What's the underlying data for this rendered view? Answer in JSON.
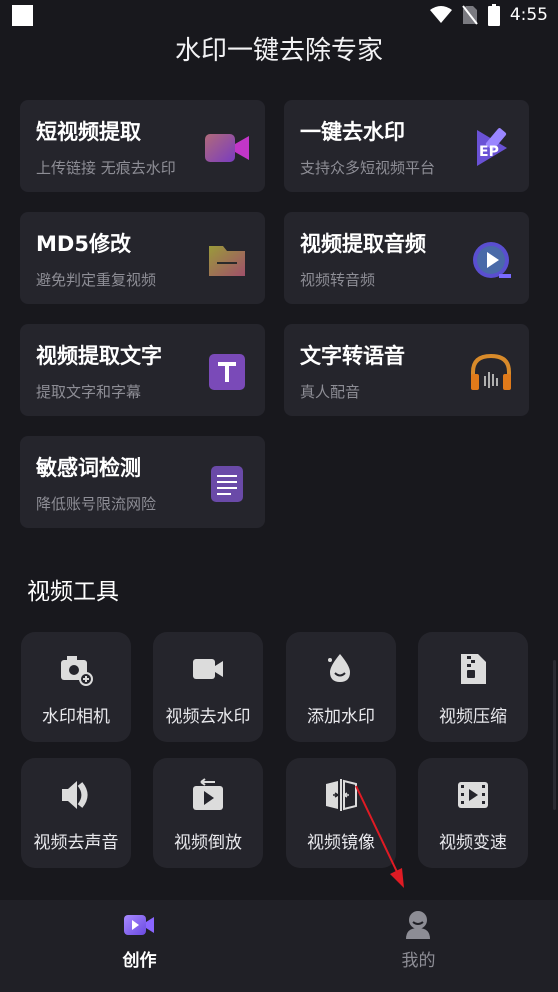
{
  "status_bar": {
    "time": "4:55"
  },
  "app": {
    "title": "水印一键去除专家"
  },
  "feature_cards": [
    {
      "title": "短视频提取",
      "subtitle": "上传链接 无痕去水印",
      "icon": "video-camera-icon"
    },
    {
      "title": "一键去水印",
      "subtitle": "支持众多短视频平台",
      "icon": "watermark-eraser-icon"
    },
    {
      "title": "MD5修改",
      "subtitle": "避免判定重复视频",
      "icon": "folder-icon"
    },
    {
      "title": "视频提取音频",
      "subtitle": "视频转音频",
      "icon": "play-audio-icon"
    },
    {
      "title": "视频提取文字",
      "subtitle": "提取文字和字幕",
      "icon": "text-t-icon"
    },
    {
      "title": "文字转语音",
      "subtitle": "真人配音",
      "icon": "headphones-icon"
    },
    {
      "title": "敏感词检测",
      "subtitle": "降低账号限流网险",
      "icon": "document-lines-icon"
    }
  ],
  "video_tools": {
    "title": "视频工具",
    "items": [
      {
        "label": "水印相机",
        "icon": "camera-add-icon"
      },
      {
        "label": "视频去水印",
        "icon": "video-camera-icon"
      },
      {
        "label": "添加水印",
        "icon": "droplet-icon"
      },
      {
        "label": "视频压缩",
        "icon": "zip-file-icon"
      },
      {
        "label": "视频去声音",
        "icon": "speaker-mute-icon"
      },
      {
        "label": "视频倒放",
        "icon": "reverse-play-icon"
      },
      {
        "label": "视频镜像",
        "icon": "mirror-icon"
      },
      {
        "label": "视频变速",
        "icon": "film-speed-icon"
      }
    ]
  },
  "bottom_nav": {
    "items": [
      {
        "label": "创作",
        "active": true
      },
      {
        "label": "我的",
        "active": false
      }
    ]
  },
  "colors": {
    "background": "#18181d",
    "card": "#25252c",
    "subtitle": "#8d8d95",
    "accent_purple": "#8a66ff",
    "annotation_arrow": "#e01b24"
  }
}
